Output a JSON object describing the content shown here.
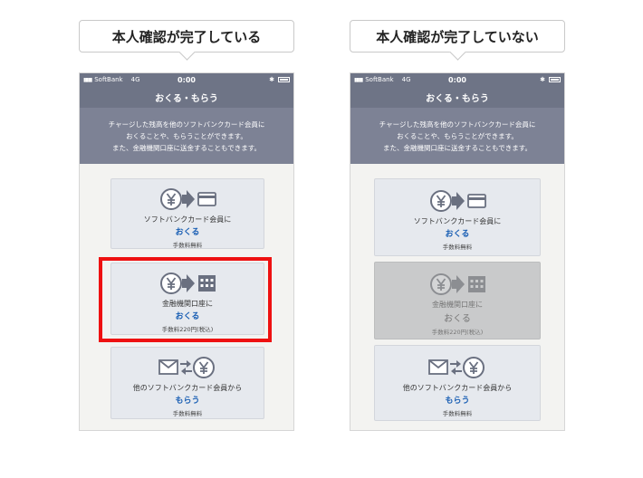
{
  "left": {
    "caption": "本人確認が完了している",
    "status": {
      "carrier": "SoftBank",
      "network": "4G",
      "time": "0:00"
    },
    "nav_title": "おくる・もらう",
    "description": [
      "チャージした残高を他のソフトバンクカード会員に",
      "おくることや、もらうことができます。",
      "また、金融機関口座に送金することもできます。"
    ],
    "cards": [
      {
        "label": "ソフトバンクカード会員に",
        "action": "おくる",
        "fee": "手数料無料"
      },
      {
        "label": "金融機関口座に",
        "action": "おくる",
        "fee": "手数料220円(税込)"
      },
      {
        "label": "他のソフトバンクカード会員から",
        "action": "もらう",
        "fee": "手数料無料"
      }
    ]
  },
  "right": {
    "caption": "本人確認が完了していない",
    "status": {
      "carrier": "SoftBank",
      "network": "4G",
      "time": "0:00"
    },
    "nav_title": "おくる・もらう",
    "description": [
      "チャージした残高を他のソフトバンクカード会員に",
      "おくることや、もらうことができます。",
      "また、金融機関口座に送金することもできます。"
    ],
    "cards": [
      {
        "label": "ソフトバンクカード会員に",
        "action": "おくる",
        "fee": "手数料無料"
      },
      {
        "label": "金融機関口座に",
        "action": "おくる",
        "fee": "手数料220円(税込)"
      },
      {
        "label": "他のソフトバンクカード会員から",
        "action": "もらう",
        "fee": "手数料無料"
      }
    ]
  },
  "icons": [
    "yen-icon",
    "arrow-right-icon",
    "card-icon",
    "bank-icon",
    "envelope-icon",
    "exchange-arrows-icon"
  ],
  "colors": {
    "nav": "#6e7486",
    "description_bg": "#7d8295",
    "action_text": "#1a5fb4",
    "highlight": "#ee1111",
    "disabled_card": "#c9cacb"
  }
}
